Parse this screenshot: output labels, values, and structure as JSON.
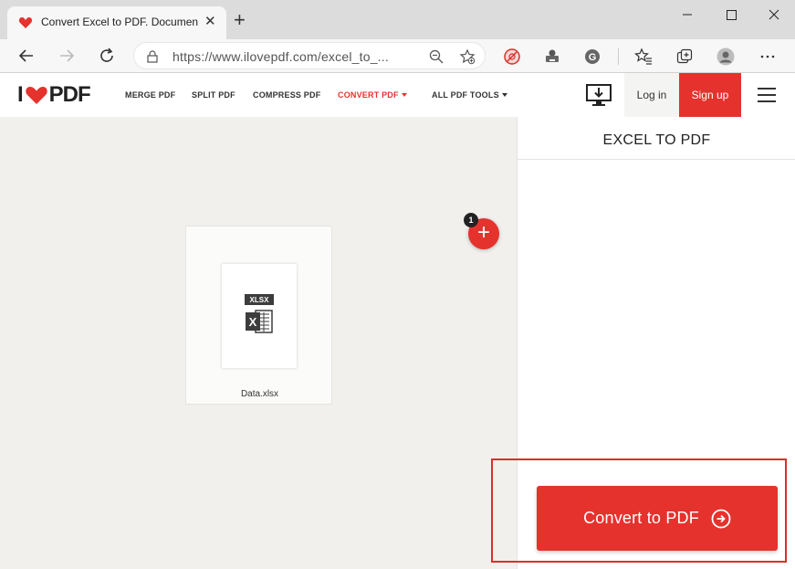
{
  "browser": {
    "tab_title": "Convert Excel to PDF. Document",
    "url": "https://www.ilovepdf.com/excel_to_..."
  },
  "header": {
    "logo_prefix": "I",
    "logo_suffix": "PDF",
    "nav": [
      {
        "label": "MERGE PDF"
      },
      {
        "label": "SPLIT PDF"
      },
      {
        "label": "COMPRESS PDF"
      },
      {
        "label": "CONVERT PDF"
      },
      {
        "label": "ALL PDF TOOLS"
      }
    ],
    "login_label": "Log in",
    "signup_label": "Sign up"
  },
  "workspace": {
    "file": {
      "name": "Data.xlsx",
      "type_label": "XLSX",
      "icon_letter": "X"
    },
    "file_count": "1"
  },
  "sidebar": {
    "title": "EXCEL TO PDF",
    "convert_label": "Convert to PDF"
  },
  "colors": {
    "brand_red": "#e5322d",
    "workspace_bg": "#f1f0ed"
  }
}
